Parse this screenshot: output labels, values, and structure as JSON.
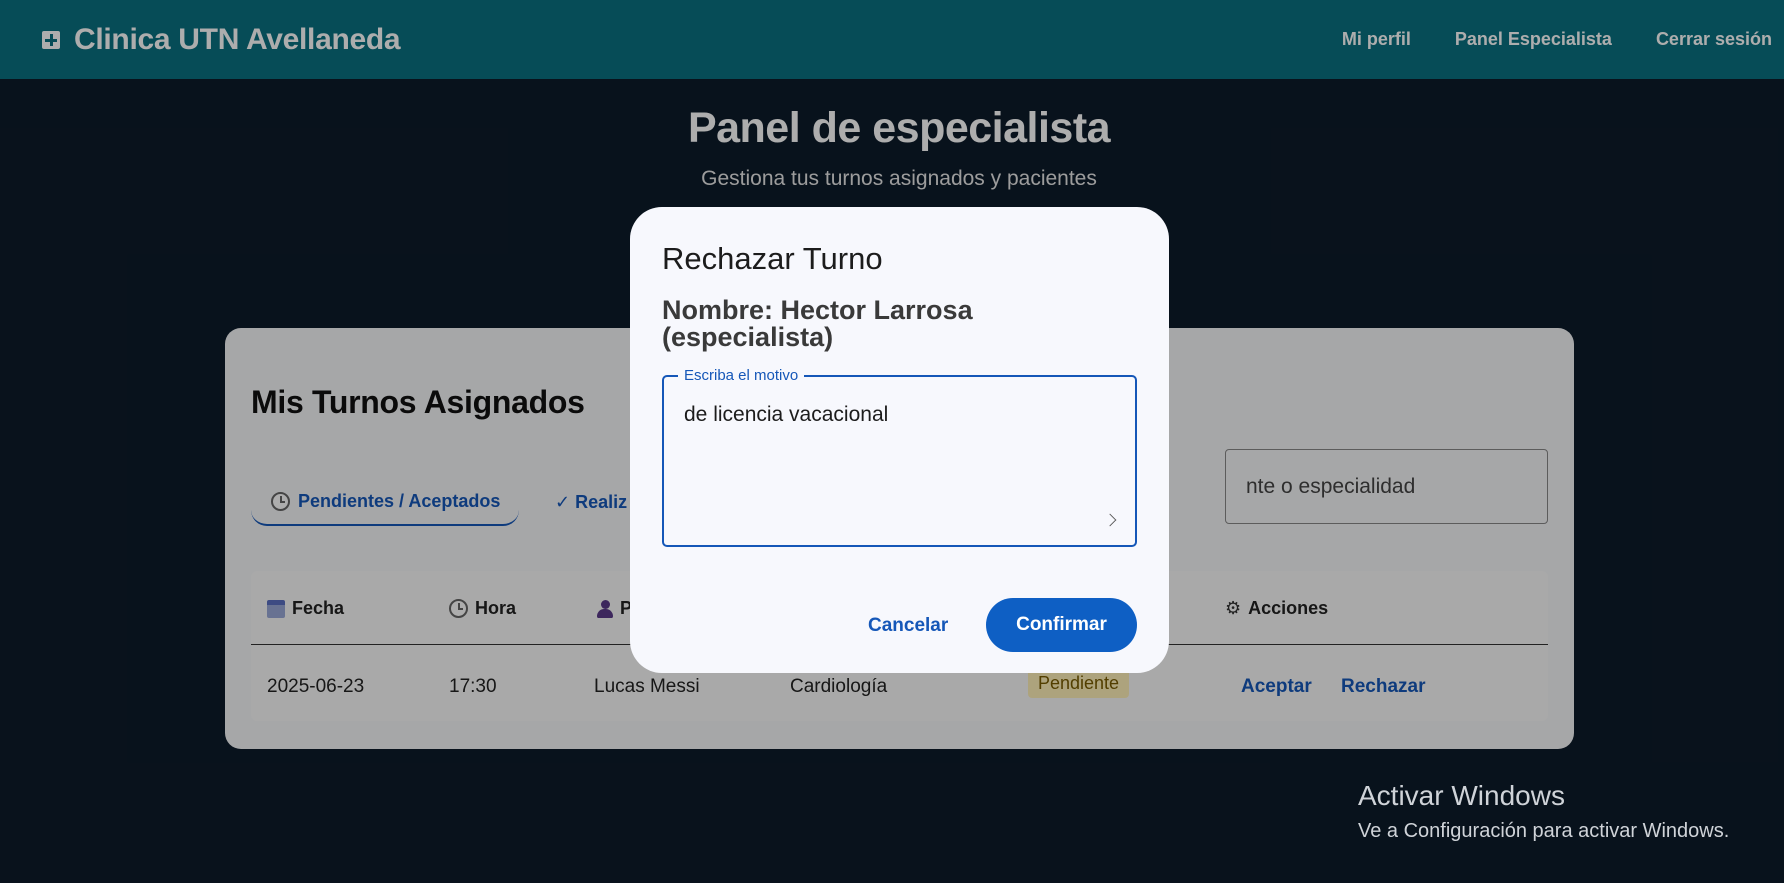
{
  "header": {
    "brand": "Clinica UTN Avellaneda",
    "nav": [
      "Mi perfil",
      "Panel Especialista",
      "Cerrar sesión"
    ]
  },
  "hero": {
    "title": "Panel de especialista",
    "subtitle": "Gestiona tus turnos asignados y pacientes"
  },
  "card": {
    "title": "Mis Turnos Asignados",
    "tabs": [
      "Pendientes / Aceptados",
      "✓ Realiz"
    ],
    "search_visible_text": "nte o especialidad",
    "columns": [
      "Fecha",
      "Hora",
      "P",
      "Acciones"
    ],
    "row": {
      "fecha": "2025-06-23",
      "hora": "17:30",
      "paciente": "Lucas Messi",
      "especialidad": "Cardiología",
      "estado": "Pendiente",
      "accion_aceptar": "Aceptar",
      "accion_rechazar": "Rechazar"
    }
  },
  "dialog": {
    "title": "Rechazar Turno",
    "name": "Nombre: Hector Larrosa (especialista)",
    "field_label": "Escriba el motivo",
    "field_value": "de licencia vacacional",
    "cancel": "Cancelar",
    "confirm": "Confirmar"
  },
  "watermark": {
    "title": "Activar Windows",
    "subtitle": "Ve a Configuración para activar Windows."
  },
  "colors": {
    "header_bg": "#0a7080",
    "page_bg": "#0d1b2a",
    "accent": "#1557b8",
    "confirm_bg": "#0e5fc4",
    "pending_badge_bg": "#fff1b8"
  }
}
